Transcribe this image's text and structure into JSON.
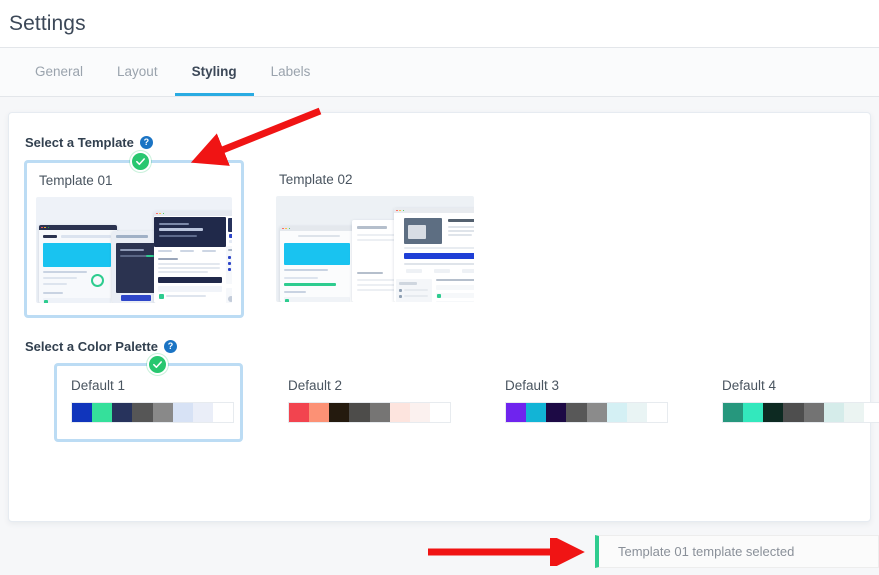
{
  "header": {
    "title": "Settings"
  },
  "tabs": [
    {
      "label": "General",
      "active": false
    },
    {
      "label": "Layout",
      "active": false
    },
    {
      "label": "Styling",
      "active": true
    },
    {
      "label": "Labels",
      "active": false
    }
  ],
  "template_section": {
    "heading": "Select a Template",
    "help_icon": "help-circle-icon",
    "items": [
      {
        "label": "Template 01",
        "selected": true,
        "theme": "dark"
      },
      {
        "label": "Template 02",
        "selected": false,
        "theme": "light"
      }
    ]
  },
  "palette_section": {
    "heading": "Select a Color Palette",
    "help_icon": "help-circle-icon",
    "items": [
      {
        "label": "Default 1",
        "selected": true,
        "colors": [
          "#1035bc",
          "#35e09b",
          "#27335c",
          "#565656",
          "#898989",
          "#d7e2f5",
          "#eaeef8",
          "#ffffff"
        ]
      },
      {
        "label": "Default 2",
        "selected": false,
        "colors": [
          "#f2444f",
          "#fc9175",
          "#241a0e",
          "#4d4c4a",
          "#767574",
          "#fde4de",
          "#fbf1ef",
          "#ffffff"
        ]
      },
      {
        "label": "Default 3",
        "selected": false,
        "colors": [
          "#6f24ee",
          "#12b4d6",
          "#1d0a45",
          "#585858",
          "#8b8b8b",
          "#d4f0f4",
          "#e9f4f4",
          "#ffffff"
        ]
      },
      {
        "label": "Default 4",
        "selected": false,
        "colors": [
          "#26977d",
          "#33e8bd",
          "#0d2a22",
          "#4e4e4e",
          "#737373",
          "#d5ecea",
          "#ebf4f2",
          "#ffffff"
        ]
      }
    ]
  },
  "toast": {
    "message": "Template 01 template selected",
    "accent": "#2ecc8f"
  },
  "annotations": [
    {
      "name": "arrow-to-template-01",
      "color": "#f01414"
    },
    {
      "name": "arrow-to-toast",
      "color": "#f01414"
    }
  ]
}
